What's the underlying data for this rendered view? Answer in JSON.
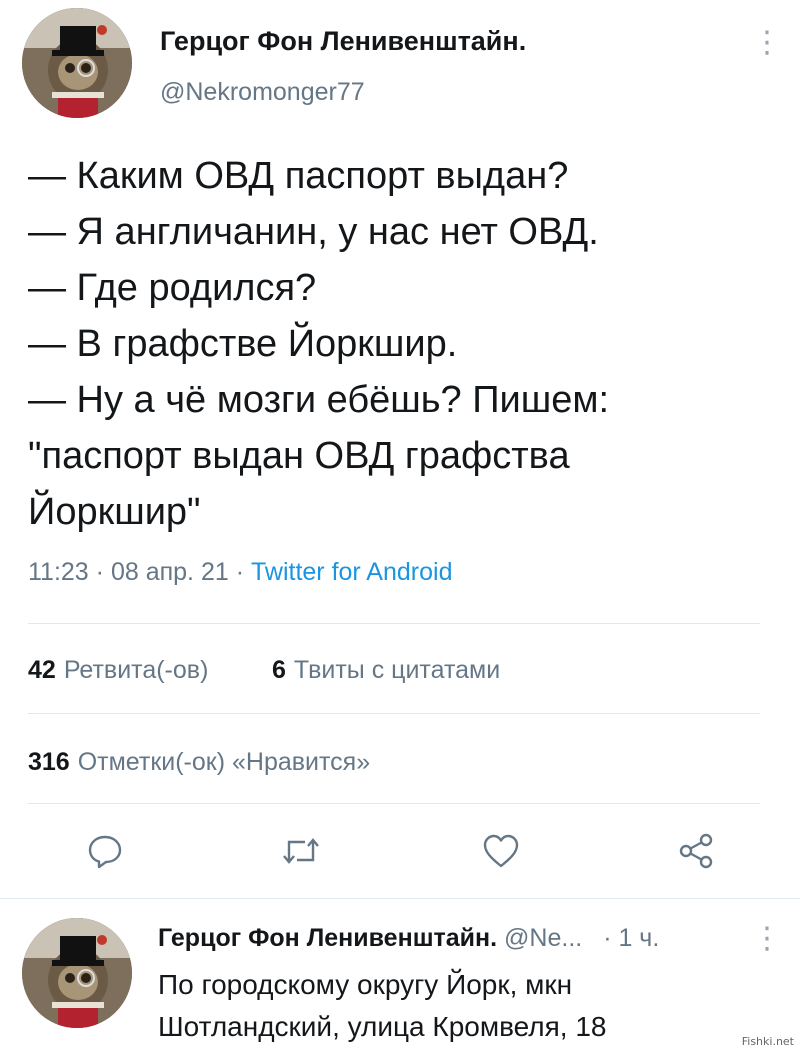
{
  "tweet": {
    "author_name": "Герцог Фон Ленивенштайн.",
    "handle": "@Nekromonger77",
    "lines": [
      "— Каким ОВД паспорт выдан?",
      "— Я англичанин, у нас нет ОВД.",
      "— Где родился?",
      "— В графстве Йоркшир.",
      "— Ну а чё мозги ебёшь? Пишем:",
      "\"паспорт выдан ОВД графства",
      "Йоркшир\""
    ],
    "time": "11:23",
    "date": "08 апр. 21",
    "source": "Twitter for Android",
    "separator": "·"
  },
  "stats": {
    "retweets_count": "42",
    "retweets_label": "Ретвита(-ов)",
    "quotes_count": "6",
    "quotes_label": "Твиты с цитатами",
    "likes_count": "316",
    "likes_label": "Отметки(-ок) «Нравится»"
  },
  "actions": {
    "icons": [
      "reply-icon",
      "retweet-icon",
      "like-icon",
      "share-icon"
    ]
  },
  "reply": {
    "author_name": "Герцог Фон Ленивенштайн.",
    "handle_truncated": "@Ne...",
    "time_ago": "· 1 ч.",
    "lines": [
      "По городскому округу Йорк, мкн",
      "Шотландский, улица Кромвеля, 18"
    ]
  },
  "watermark": "Fishki.net",
  "colors": {
    "text": "#14171a",
    "muted": "#657786",
    "link": "#1b95e0",
    "divider": "#e1e8ed"
  }
}
